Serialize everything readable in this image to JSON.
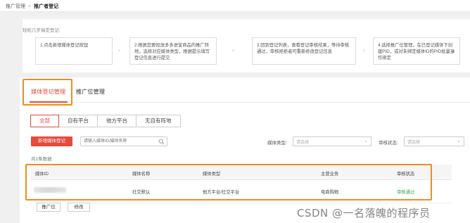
{
  "breadcrumb": {
    "parent": "推广管理",
    "separator": ">",
    "current": "推广者登记"
  },
  "guide": {
    "title": "轻松几步搞定登记:",
    "steps": [
      "1.点击新增媒体登记按钮",
      "2.根据您要投放多多进宝商品的推广阵地，选择对应媒体类型，根据提示填写登记信息进行提交",
      "3.回到登记列表，查看登记审核结果，等待审核通过，审核拒绝者可重新修改登记信息",
      "4.选择推广位管理，在已登记媒体下创建PID，或对未绑定媒体ID的PID批量操作绑定"
    ],
    "arrow": "›"
  },
  "tabs": [
    {
      "label": "媒体登记管理"
    },
    {
      "label": "推广位管理"
    }
  ],
  "segments": [
    "全部",
    "自有平台",
    "他方平台",
    "无自有阵地"
  ],
  "toolbar": {
    "add_button": "新增媒体登记",
    "search_placeholder": "请输入媒体ID/媒体名称",
    "media_type_label": "媒体类型:",
    "media_type_placeholder": "请选择",
    "review_status_label": "审核状态:",
    "review_status_placeholder": "请选择"
  },
  "count_text": "共1条数据",
  "table": {
    "headers": [
      "媒体ID",
      "媒体名称",
      "媒体类型",
      "主营业务",
      "审核状态"
    ],
    "rows": [
      {
        "id": "",
        "name": "社交默认",
        "type": "他方平台/社交平台",
        "business": "电商购物",
        "status": "审核通过"
      }
    ]
  },
  "row_actions": {
    "pid": "推广位",
    "edit": "修改"
  },
  "watermark": "CSDN @一名落魄的程序员",
  "colors": {
    "accent": "#e54a3c",
    "highlight": "#f38b1c",
    "success": "#3aa44b"
  }
}
